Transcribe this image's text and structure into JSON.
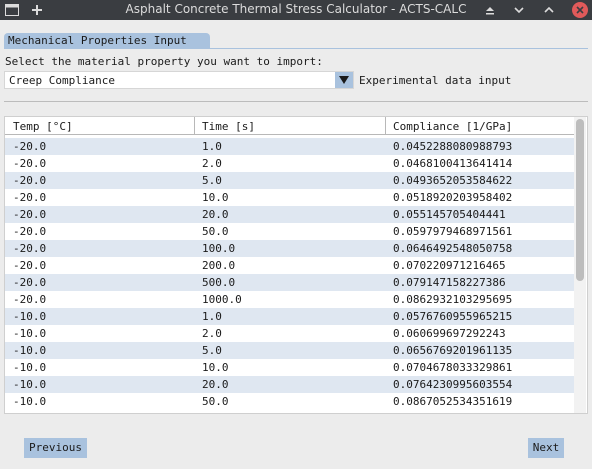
{
  "window": {
    "title": "Asphalt Concrete Thermal Stress Calculator - ACTS-CALC",
    "icons": [
      "window-menu-icon",
      "plus-icon",
      "keep-above-icon",
      "minimize-icon",
      "maximize-icon",
      "close-icon"
    ]
  },
  "tab": {
    "label": "Mechanical Properties Input"
  },
  "material": {
    "prompt": "Select the material property you want to import:",
    "selected": "Creep Compliance",
    "option_label": "Experimental data input"
  },
  "table": {
    "headers": [
      "Temp [°C]",
      "Time [s]",
      "Compliance [1/GPa]"
    ],
    "rows": [
      [
        "-20.0",
        "1.0",
        "0.0452288080988793"
      ],
      [
        "-20.0",
        "2.0",
        "0.0468100413641414"
      ],
      [
        "-20.0",
        "5.0",
        "0.0493652053584622"
      ],
      [
        "-20.0",
        "10.0",
        "0.0518920203958402"
      ],
      [
        "-20.0",
        "20.0",
        "0.055145705404441"
      ],
      [
        "-20.0",
        "50.0",
        "0.0597979468971561"
      ],
      [
        "-20.0",
        "100.0",
        "0.0646492548050758"
      ],
      [
        "-20.0",
        "200.0",
        "0.070220971216465"
      ],
      [
        "-20.0",
        "500.0",
        "0.079147158227386"
      ],
      [
        "-20.0",
        "1000.0",
        "0.0862932103295695"
      ],
      [
        "-10.0",
        "1.0",
        "0.0576760955965215"
      ],
      [
        "-10.0",
        "2.0",
        "0.060699697292243"
      ],
      [
        "-10.0",
        "5.0",
        "0.0656769201961135"
      ],
      [
        "-10.0",
        "10.0",
        "0.0704678033329861"
      ],
      [
        "-10.0",
        "20.0",
        "0.0764230995603554"
      ],
      [
        "-10.0",
        "50.0",
        "0.0867052534351619"
      ]
    ]
  },
  "nav": {
    "previous": "Previous",
    "next": "Next"
  }
}
